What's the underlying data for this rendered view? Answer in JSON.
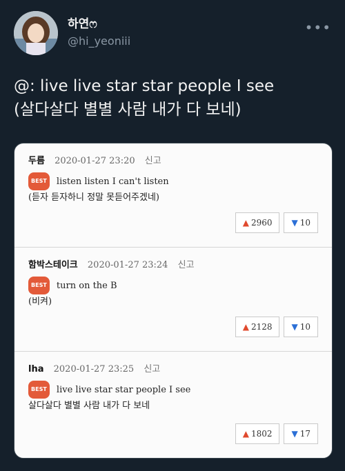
{
  "user": {
    "display_name": "하연ෆ",
    "handle": "@hi_yeoniii"
  },
  "more_icon": "more-horizontal-icon",
  "tweet": {
    "line1": "@: live live star star people I see",
    "line2": "(살다살다 별별 사람 내가 다 보네)"
  },
  "comments": [
    {
      "author": "두름",
      "date": "2020-01-27 23:20",
      "report": "신고",
      "best": "BEST",
      "text": "listen listen I can't listen",
      "translation": "(듣자 듣자하니 정말 못듣어주겠네)",
      "likes": "2960",
      "dislikes": "10"
    },
    {
      "author": "함박스테이크",
      "date": "2020-01-27 23:24",
      "report": "신고",
      "best": "BEST",
      "text": "turn on the B",
      "translation": "(비켜)",
      "likes": "2128",
      "dislikes": "10"
    },
    {
      "author": "lha",
      "date": "2020-01-27 23:25",
      "report": "신고",
      "best": "BEST",
      "text": "live live star star people I see",
      "translation": "살다살다 별별 사람 내가 다 보네",
      "likes": "1802",
      "dislikes": "17"
    }
  ],
  "colors": {
    "background": "#15202b",
    "best_badge": "#e35a39",
    "like": "#e04a2e",
    "dislike": "#2b6fd6"
  }
}
